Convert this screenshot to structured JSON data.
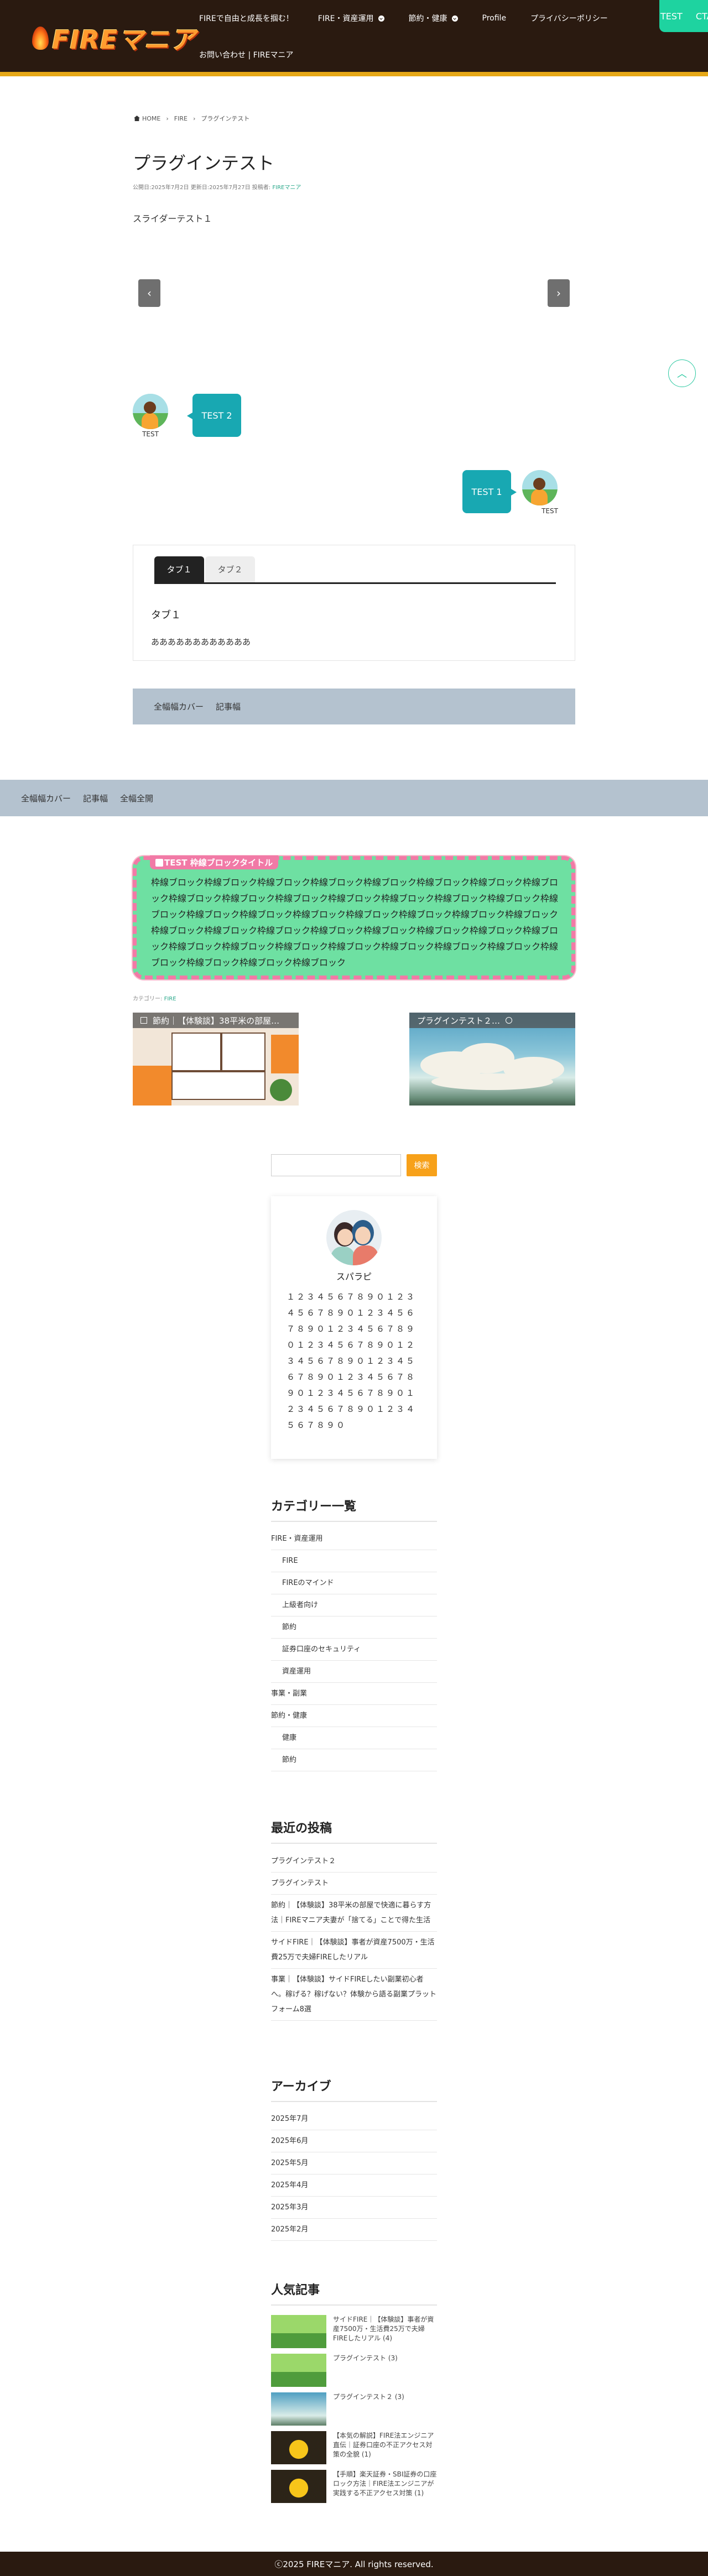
{
  "site": {
    "logo_text": "FIREマニア",
    "nav_row1": [
      {
        "label": "FIREで自由と成長を掴む！",
        "dropdown": false
      },
      {
        "label": "FIRE・資産運用",
        "dropdown": true
      },
      {
        "label": "節約・健康",
        "dropdown": true
      },
      {
        "label": "Profile",
        "dropdown": false
      },
      {
        "label": "プライバシーポリシー",
        "dropdown": false
      }
    ],
    "nav_row2": [
      {
        "label": "お問い合わせ | FIREマニア",
        "dropdown": false
      }
    ],
    "cta": [
      "TEST",
      "CTA"
    ],
    "accent_color": "#1ed3a0",
    "header_bg": "#2a1a10"
  },
  "breadcrumb": [
    "HOME",
    "FIRE",
    "プラグインテスト"
  ],
  "article": {
    "title": "プラグインテスト",
    "meta_prefix": "公開日:2025年7月2日 更新日:2025年7月27日 投稿者:",
    "meta_author": "FIREマニア",
    "slider_label": "スライダーテスト１",
    "slider_prev": "‹",
    "slider_next": "›",
    "scroll_top": "︿",
    "balloons": [
      {
        "side": "left",
        "name": "TEST",
        "text": "TEST 2"
      },
      {
        "side": "right",
        "name": "TEST",
        "text": "TEST 1"
      }
    ],
    "tabs": [
      "タブ１",
      "タブ２"
    ],
    "tab_heading": "タブ１",
    "tab_text": "ああああああああああああ",
    "cover_narrow": [
      "全幅幅カバー",
      "記事幅"
    ],
    "cover_wide": [
      "全幅幅カバー",
      "記事幅",
      "全幅全開"
    ],
    "frame_title": "TEST 枠線ブロックタイトル",
    "frame_body": "枠線ブロック枠線ブロック枠線ブロック枠線ブロック枠線ブロック枠線ブロック枠線ブロック枠線ブロック枠線ブロック枠線ブロック枠線ブロック枠線ブロック枠線ブロック枠線ブロック枠線ブロック枠線ブロック枠線ブロック枠線ブロック枠線ブロック枠線ブロック枠線ブロック枠線ブロック枠線ブロック枠線ブロック枠線ブロック枠線ブロック枠線ブロック枠線ブロック枠線ブロック枠線ブロック枠線ブロック枠線ブロック枠線ブロック枠線ブロック枠線ブロック枠線ブロック枠線ブロック枠線ブロック枠線ブロック枠線ブロック枠線ブロック枠線ブロック",
    "category_caption_prefix": "カテゴリー:",
    "category_caption_link": "FIRE",
    "related": [
      {
        "title": "節約｜【体験談】38平米の部屋…"
      },
      {
        "title": "プラグインテスト２…"
      }
    ]
  },
  "sidebar": {
    "search_placeholder": "",
    "search_button": "検索",
    "profile": {
      "name": "スパラピ",
      "text": "１２３４５６７８９０１２３４５６７８９０１２３４５６７８９０１２３４５６７８９０１２３４５６７８９０１２３４５６７８９０１２３４５６７８９０１２３４５６７８９０１２３４５６７８９０１２３４５６７８９０１２３４５６７８９０"
    },
    "categories_title": "カテゴリー一覧",
    "categories": [
      {
        "label": "FIRE・資産運用",
        "child": false
      },
      {
        "label": "FIRE",
        "child": true
      },
      {
        "label": "FIREのマインド",
        "child": true
      },
      {
        "label": "上級者向け",
        "child": true
      },
      {
        "label": "節約",
        "child": true
      },
      {
        "label": "証券口座のセキュリティ",
        "child": true
      },
      {
        "label": "資産運用",
        "child": true
      },
      {
        "label": "事業・副業",
        "child": false
      },
      {
        "label": "節約・健康",
        "child": false
      },
      {
        "label": "健康",
        "child": true
      },
      {
        "label": "節約",
        "child": true
      }
    ],
    "recent_title": "最近の投稿",
    "recent": [
      "プラグインテスト２",
      "プラグインテスト",
      "節約｜【体験談】38平米の部屋で快適に暮らす方法｜FIREマニア夫妻が「捨てる」ことで得た生活",
      "サイドFIRE｜【体験談】事者が資産7500万・生活費25万で夫婦FIREしたリアル",
      "事業｜【体験談】サイドFIREしたい副業初心者へ。稼げる？稼げない？体験から語る副業プラットフォーム8選"
    ],
    "archive_title": "アーカイブ",
    "archive": [
      "2025年7月",
      "2025年6月",
      "2025年5月",
      "2025年4月",
      "2025年3月",
      "2025年2月"
    ],
    "popular_title": "人気記事",
    "popular": [
      {
        "text": "サイドFIRE｜【体験談】事者が資産7500万・生活費25万で夫婦FIREしたリアル (4)",
        "thumb": "fire"
      },
      {
        "text": "プラグインテスト (3)",
        "thumb": "fire"
      },
      {
        "text": "プラグインテスト２ (3)",
        "thumb": "sky"
      },
      {
        "text": "【本気の解説】FIRE法エンジニア直伝｜証券口座の不正アクセス対策の全貌 (1)",
        "thumb": "lock"
      },
      {
        "text": "【手順】楽天証券・SBI証券の口座ロック方法｜FIRE法エンジニアが実践する不正アクセス対策 (1)",
        "thumb": "lock"
      }
    ]
  },
  "footer": {
    "copyright": "ⓒ2025 FIREマニア. All rights reserved."
  }
}
